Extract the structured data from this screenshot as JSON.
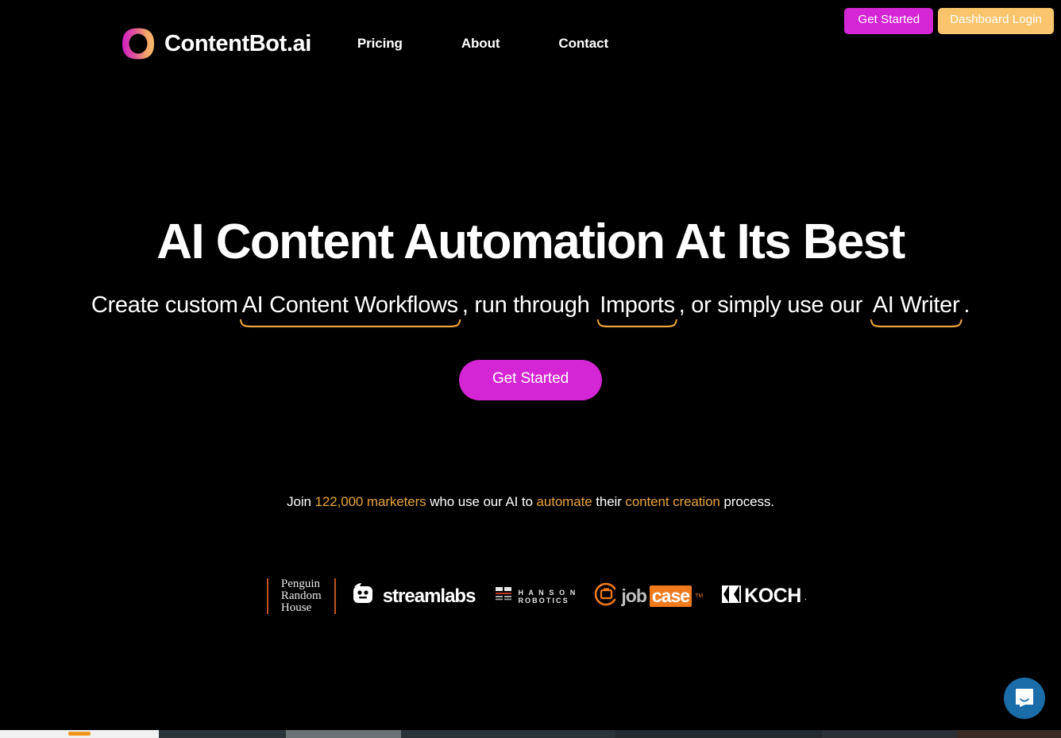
{
  "page": {
    "background_color": "#000000",
    "accent_magenta": "#D426D4",
    "accent_amber": "#E8A33D",
    "accent_tan": "#FAC46C",
    "accent_orange": "#F07B1D"
  },
  "header": {
    "brand_name": "ContentBot.ai",
    "logo_icon": "ring-gradient-logo",
    "nav": [
      {
        "label": "Pricing"
      },
      {
        "label": "About"
      },
      {
        "label": "Contact"
      }
    ],
    "auth": {
      "get_started_label": "Get Started",
      "dashboard_login_label": "Dashboard Login"
    }
  },
  "hero": {
    "title": "AI Content Automation At Its Best",
    "subtitle": {
      "part1": "Create custom",
      "highlight1": "AI Content Workflows",
      "part2": ", run through ",
      "highlight2": "Imports",
      "part3": ", or simply use our ",
      "highlight3": "AI Writer",
      "part4": "."
    },
    "cta_label": "Get Started"
  },
  "social_proof": {
    "lead": "Join ",
    "count": "122,000 marketers",
    "mid1": " who use our AI to ",
    "verb": "automate",
    "mid2": " their ",
    "noun": "content creation",
    "tail": " process."
  },
  "clients": {
    "penguin": {
      "line1": "Penguin",
      "line2": "Random",
      "line3": "House"
    },
    "streamlabs": {
      "label": "streamlabs"
    },
    "hanson": {
      "line1": "H A N S O N",
      "line2": "ROBOTICS"
    },
    "jobcase": {
      "part1": "job",
      "part2": "case",
      "tm": "TM"
    },
    "koch": {
      "label": "KOCH",
      "suffix": "."
    }
  },
  "chat": {
    "launcher_icon": "chat-bubble-icon",
    "launcher_color": "#1A6DA8"
  }
}
